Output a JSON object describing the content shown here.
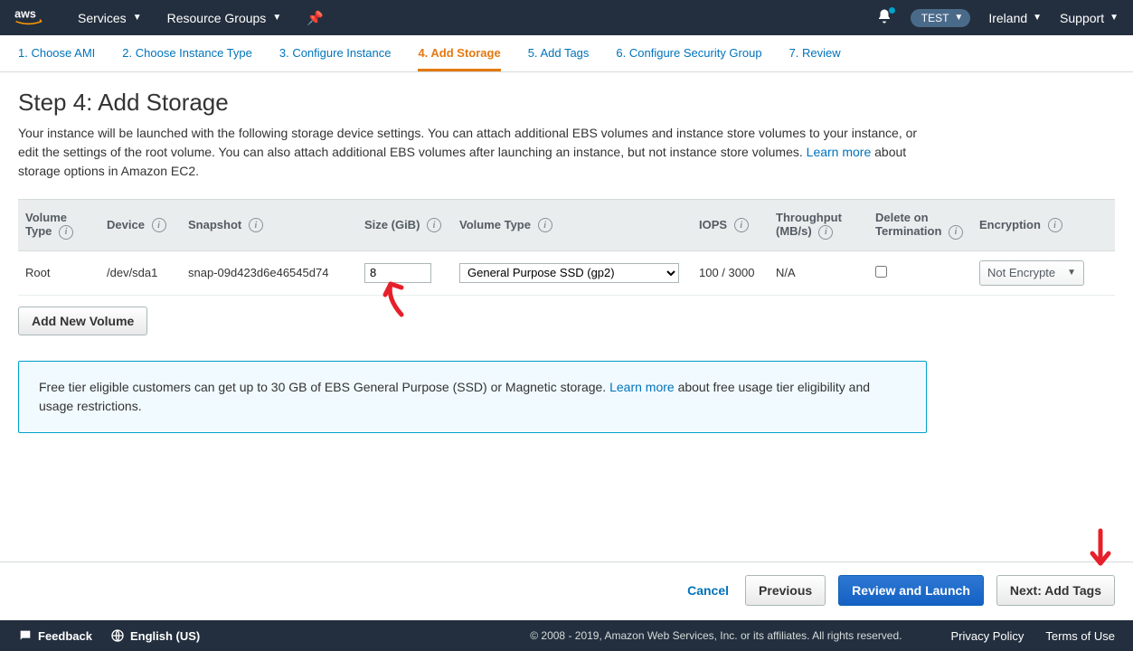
{
  "nav": {
    "services": "Services",
    "resource_groups": "Resource Groups",
    "account": "TEST",
    "region": "Ireland",
    "support": "Support"
  },
  "wizard": {
    "tabs": [
      "1. Choose AMI",
      "2. Choose Instance Type",
      "3. Configure Instance",
      "4. Add Storage",
      "5. Add Tags",
      "6. Configure Security Group",
      "7. Review"
    ]
  },
  "page": {
    "title": "Step 4: Add Storage",
    "desc1": "Your instance will be launched with the following storage device settings. You can attach additional EBS volumes and instance store volumes to your instance, or edit the settings of the root volume. You can also attach additional EBS volumes after launching an instance, but not instance store volumes. ",
    "learn_more": "Learn more",
    "desc2": " about storage options in Amazon EC2."
  },
  "table": {
    "headers": {
      "volume_type": "Volume Type",
      "device": "Device",
      "snapshot": "Snapshot",
      "size": "Size (GiB)",
      "voltype": "Volume Type",
      "iops": "IOPS",
      "throughput": "Throughput (MB/s)",
      "delete": "Delete on Termination",
      "encryption": "Encryption"
    },
    "row": {
      "volume_type": "Root",
      "device": "/dev/sda1",
      "snapshot": "snap-09d423d6e46545d74",
      "size": "8",
      "voltype_sel": "General Purpose SSD (gp2)",
      "iops": "100 / 3000",
      "throughput": "N/A",
      "encryption": "Not Encrypte"
    },
    "add_button": "Add New Volume"
  },
  "info": {
    "text1": "Free tier eligible customers can get up to 30 GB of EBS General Purpose (SSD) or Magnetic storage. ",
    "learn_more": "Learn more",
    "text2": " about free usage tier eligibility and usage restrictions."
  },
  "footer": {
    "cancel": "Cancel",
    "previous": "Previous",
    "review": "Review and Launch",
    "next": "Next: Add Tags"
  },
  "bottom": {
    "feedback": "Feedback",
    "language": "English (US)",
    "copyright": "© 2008 - 2019, Amazon Web Services, Inc. or its affiliates. All rights reserved.",
    "privacy": "Privacy Policy",
    "terms": "Terms of Use"
  }
}
